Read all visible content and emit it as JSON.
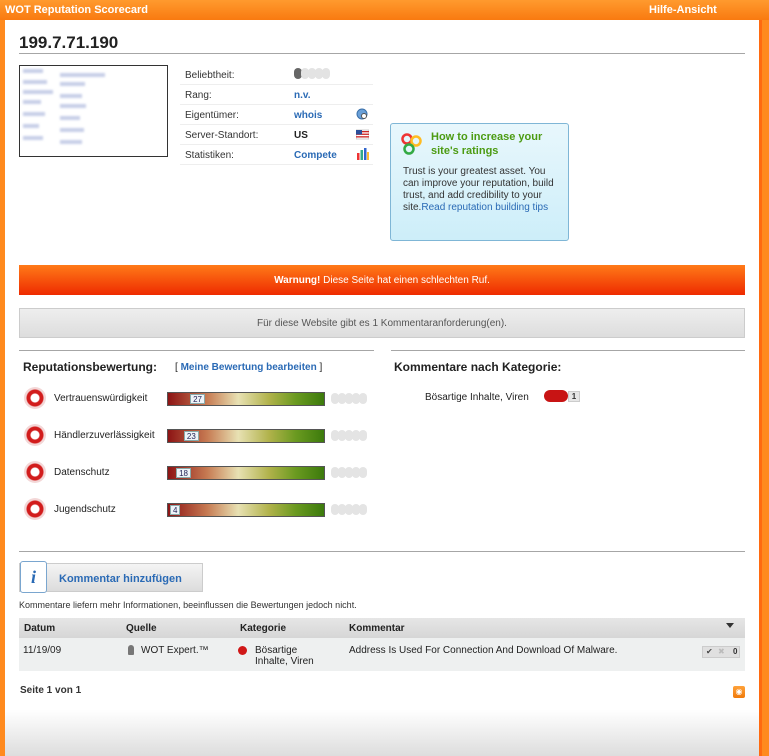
{
  "app": {
    "title": "WOT Reputation Scorecard",
    "help_link": "Hilfe-Ansicht"
  },
  "site": {
    "hostname": "199.7.71.190"
  },
  "info": {
    "popularity": {
      "label": "Beliebtheit:"
    },
    "rank": {
      "label": "Rang:",
      "value": "n.v."
    },
    "owner": {
      "label": "Eigentümer:",
      "value": "whois",
      "icon": "globe-search-icon"
    },
    "location": {
      "label": "Server-Standort:",
      "value": "US",
      "icon": "us-flag-icon"
    },
    "stats": {
      "label": "Statistiken:",
      "value": "Compete",
      "icon": "bar-stats-icon"
    }
  },
  "promo": {
    "title": "How to increase your site's ratings",
    "body": "Trust is your greatest asset. You can improve your reputation, build trust, and add credibility to your site.",
    "link": "Read reputation building tips"
  },
  "warning": {
    "strong": "Warnung!",
    "text": " Diese Seite hat einen schlechten Ruf."
  },
  "comment_request": "Für diese Website gibt es 1 Kommentaranforderung(en).",
  "reputation": {
    "title": "Reputationsbewertung:",
    "edit_prefix": "[ ",
    "edit_link": "Meine Bewertung bearbeiten",
    "edit_suffix": " ]",
    "rows": [
      {
        "label": "Vertrauenswürdigkeit",
        "score": "27"
      },
      {
        "label": "Händlerzuverlässigkeit",
        "score": "23"
      },
      {
        "label": "Datenschutz",
        "score": "18"
      },
      {
        "label": "Jugendschutz",
        "score": "4"
      }
    ]
  },
  "categories": {
    "title": "Kommentare nach Kategorie:",
    "items": [
      {
        "label": "Bösartige Inhalte, Viren",
        "count": "1",
        "color": "#c81414"
      }
    ]
  },
  "comments": {
    "add_button": "Kommentar hinzufügen",
    "note": "Kommentare liefern mehr Informationen, beeinflussen die Bewertungen jedoch nicht.",
    "columns": {
      "date": "Datum",
      "source": "Quelle",
      "category": "Kategorie",
      "comment": "Kommentar"
    },
    "rows": [
      {
        "date": "11/19/09",
        "source": "WOT Expert.™",
        "category_line1": "Bösartige",
        "category_line2": "Inhalte, Viren",
        "comment": "Address Is Used For Connection And Download Of Malware.",
        "votes": "0"
      }
    ],
    "pager": "Seite 1 von 1"
  }
}
